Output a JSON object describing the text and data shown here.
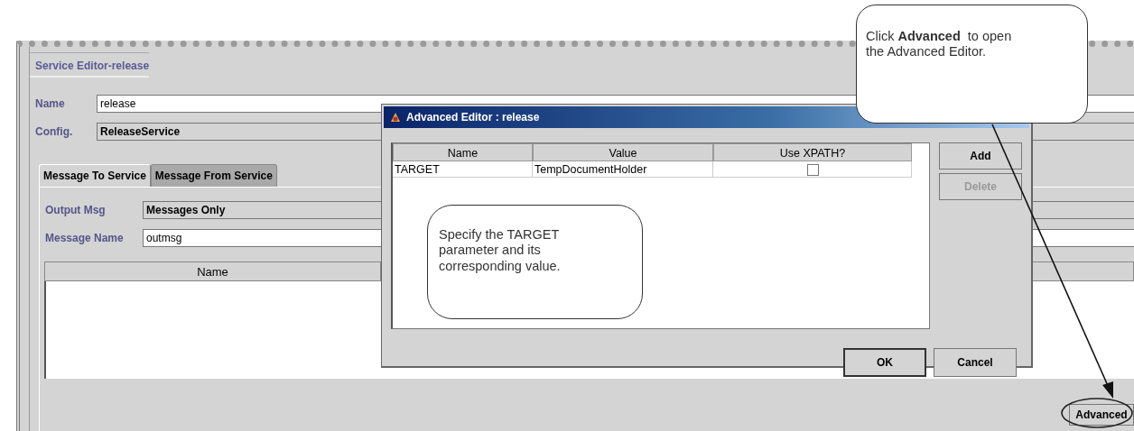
{
  "editor": {
    "title": "Service Editor-release",
    "fields": [
      {
        "label": "Name",
        "value": "release",
        "kind": "text"
      },
      {
        "label": "Config.",
        "value": "ReleaseService",
        "kind": "select"
      }
    ],
    "tabs": [
      {
        "label": "Message To Service",
        "selected": true
      },
      {
        "label": "Message From Service",
        "selected": false
      }
    ],
    "message_fields": [
      {
        "label": "Output Msg",
        "value": "Messages Only",
        "kind": "select"
      },
      {
        "label": "Message Name",
        "value": "outmsg",
        "kind": "text"
      }
    ],
    "table": {
      "columns": [
        "Name"
      ]
    },
    "buttons": [
      {
        "label": "Advanced",
        "disabled": false
      }
    ]
  },
  "dialog": {
    "title": "Advanced Editor : release",
    "table": {
      "columns": [
        "Name",
        "Value",
        "Use XPATH?"
      ],
      "rows": [
        {
          "name": "TARGET",
          "value": "TempDocumentHolder",
          "use_xpath": false
        }
      ]
    },
    "side_buttons": [
      {
        "label": "Add",
        "disabled": false
      },
      {
        "label": "Delete",
        "disabled": true
      }
    ],
    "buttons": [
      {
        "label": "OK",
        "focused": true
      },
      {
        "label": "Cancel",
        "focused": false
      }
    ]
  },
  "callouts": [
    {
      "text": "Click **Advanced**  to open the Advanced Editor."
    },
    {
      "text": "Specify the TARGET parameter and its corresponding value."
    }
  ]
}
